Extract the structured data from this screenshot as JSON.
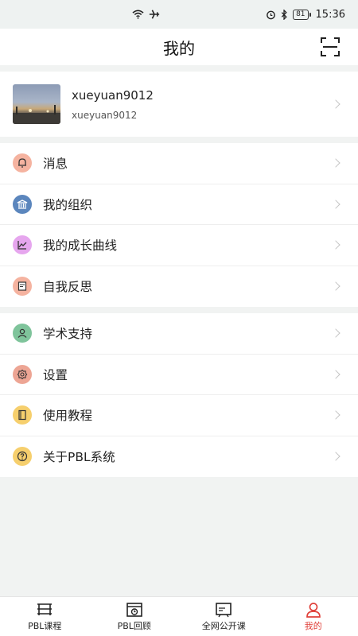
{
  "status": {
    "time": "15:36",
    "battery": "81"
  },
  "header": {
    "title": "我的"
  },
  "profile": {
    "name": "xueyuan9012",
    "username": "xueyuan9012"
  },
  "menu_group1": [
    {
      "label": "消息",
      "icon": "bell-icon",
      "color": "#f08a6e"
    },
    {
      "label": "我的组织",
      "icon": "organization-icon",
      "color": "#4f7fb8"
    },
    {
      "label": "我的成长曲线",
      "icon": "growth-chart-icon",
      "color": "#d88ee0"
    },
    {
      "label": "自我反思",
      "icon": "reflection-icon",
      "color": "#f08a6e"
    }
  ],
  "menu_group2": [
    {
      "label": "学术支持",
      "icon": "user-support-icon",
      "color": "#6bb58a"
    },
    {
      "label": "设置",
      "icon": "settings-icon",
      "color": "#e8907c"
    },
    {
      "label": "使用教程",
      "icon": "tutorial-icon",
      "color": "#f3c14f"
    },
    {
      "label": "关于PBL系统",
      "icon": "help-icon",
      "color": "#f3c14f"
    }
  ],
  "tabs": [
    {
      "label": "PBL课程",
      "icon": "courses-icon"
    },
    {
      "label": "PBL回顾",
      "icon": "review-icon"
    },
    {
      "label": "全网公开课",
      "icon": "public-course-icon"
    },
    {
      "label": "我的",
      "icon": "profile-icon",
      "active": true
    }
  ],
  "colors": {
    "accent": "#e0413a",
    "background": "#f1f3f2"
  }
}
